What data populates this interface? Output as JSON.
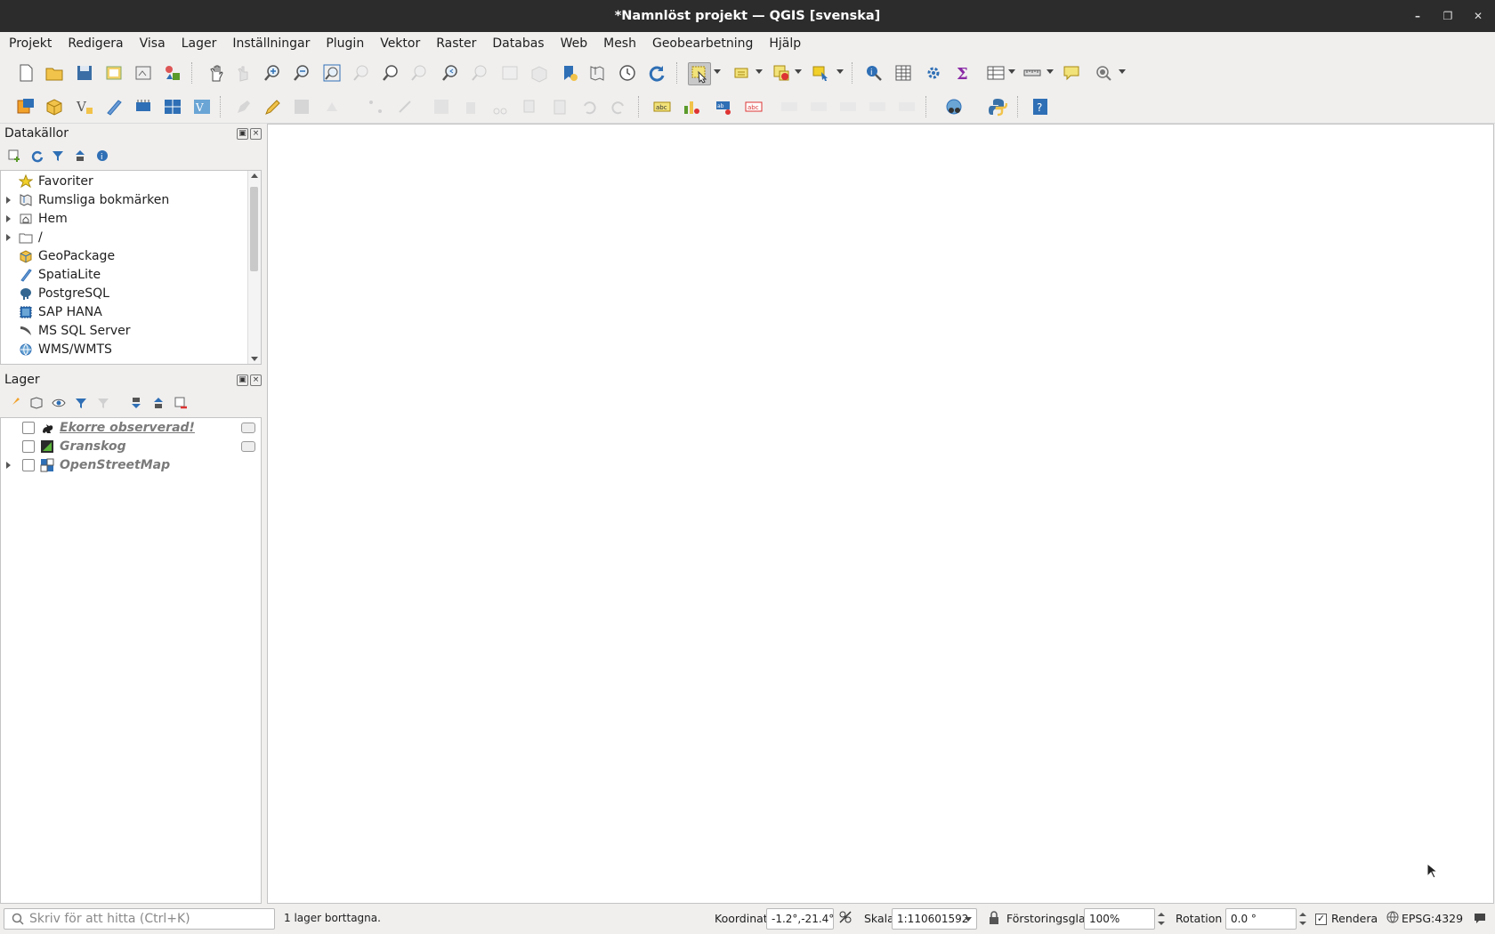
{
  "window": {
    "title": "*Namnlöst projekt — QGIS [svenska]"
  },
  "menu": [
    "Projekt",
    "Redigera",
    "Visa",
    "Lager",
    "Inställningar",
    "Plugin",
    "Vektor",
    "Raster",
    "Databas",
    "Web",
    "Mesh",
    "Geobearbetning",
    "Hjälp"
  ],
  "browser": {
    "title": "Datakällor",
    "items": [
      {
        "label": "Favoriter",
        "icon": "star-icon",
        "expandable": false
      },
      {
        "label": "Rumsliga bokmärken",
        "icon": "bookmark-icon",
        "expandable": true
      },
      {
        "label": "Hem",
        "icon": "home-folder-icon",
        "expandable": true
      },
      {
        "label": "/",
        "icon": "folder-icon",
        "expandable": true
      },
      {
        "label": "GeoPackage",
        "icon": "geopackage-icon",
        "expandable": false
      },
      {
        "label": "SpatiaLite",
        "icon": "spatialite-icon",
        "expandable": false
      },
      {
        "label": "PostgreSQL",
        "icon": "postgresql-icon",
        "expandable": false
      },
      {
        "label": "SAP HANA",
        "icon": "sap-hana-icon",
        "expandable": false
      },
      {
        "label": "MS SQL Server",
        "icon": "mssql-icon",
        "expandable": false
      },
      {
        "label": "WMS/WMTS",
        "icon": "wms-icon",
        "expandable": false
      }
    ]
  },
  "layers": {
    "title": "Lager",
    "items": [
      {
        "label": "Ekorre observerad!",
        "icon": "squirrel-point-icon",
        "underline": true,
        "expandable": false,
        "embedded": true
      },
      {
        "label": "Granskog",
        "icon": "polygon-layer-icon",
        "underline": false,
        "expandable": false,
        "embedded": true
      },
      {
        "label": "OpenStreetMap",
        "icon": "raster-tiles-icon",
        "underline": false,
        "expandable": true,
        "embedded": false
      }
    ]
  },
  "status": {
    "search_placeholder": "Skriv för att hitta (Ctrl+K)",
    "message": "1 lager borttagna.",
    "coord_label": "Koordinat",
    "coord_value": "-1.2°,-21.4°",
    "scale_label": "Skala",
    "scale_value": "1:110601592",
    "magnifier_label": "Förstoringsglas",
    "magnifier_value": "100%",
    "rotation_label": "Rotation",
    "rotation_value": "0.0 °",
    "render_label": "Rendera",
    "render_checked": true,
    "crs": "EPSG:4329"
  },
  "colors": {
    "titlebar": "#2c2c2c",
    "panel_bg": "#f0efee",
    "accent_green": "#5a9a2a",
    "accent_blue": "#2f6fb5",
    "accent_yellow": "#e8c430"
  }
}
